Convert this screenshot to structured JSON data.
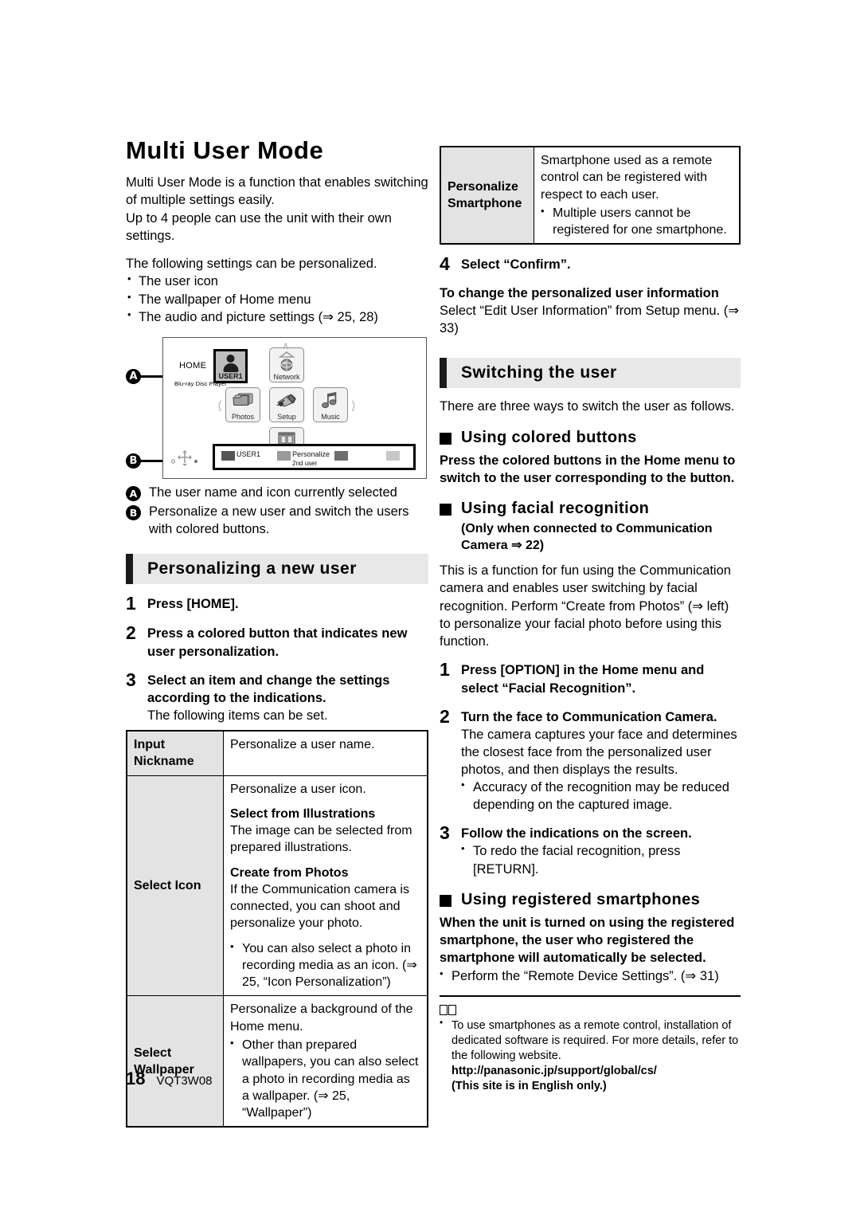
{
  "document": {
    "title": "Multi User Mode",
    "page_number": "18",
    "doc_code": "VQT3W08"
  },
  "left_column": {
    "intro_paragraph_1": "Multi User Mode is a function that enables switching of multiple settings easily.",
    "intro_paragraph_2": "Up to 4 people can use the unit with their own settings.",
    "personalized_lead": "The following settings can be personalized.",
    "personalized_items": [
      "The user icon",
      "The wallpaper of Home menu",
      "The audio and picture settings (⇒ 25, 28)"
    ],
    "figure": {
      "home_label": "HOME",
      "brand_label": "Blu-ray Disc Player",
      "user_tile_label": "USER1",
      "callout_a": "A",
      "callout_b": "B",
      "menu_items": [
        "Network",
        "Photos",
        "Setup",
        "Music",
        "Videos"
      ],
      "color_buttons": [
        {
          "label": "USER1",
          "sub": "",
          "color": "#555555"
        },
        {
          "label": "Personalize",
          "sub": "2nd user",
          "color": "#9a9a9a"
        },
        {
          "label": "",
          "sub": "",
          "color": "#6e6e6e"
        },
        {
          "label": "",
          "sub": "",
          "color": "#c7c7c7"
        }
      ]
    },
    "legend": [
      {
        "mark": "A",
        "text": "The user name and icon currently selected"
      },
      {
        "mark": "B",
        "text": "Personalize a new user and switch the users with colored buttons."
      }
    ],
    "section_heading": "Personalizing a new user",
    "steps": [
      {
        "num": "1",
        "text": "Press [HOME]."
      },
      {
        "num": "2",
        "text": "Press a colored button that indicates new user personalization."
      },
      {
        "num": "3",
        "text": "Select an item and change the settings according to the indications.",
        "sub": "The following items can be set."
      }
    ],
    "settings_table": [
      {
        "header": "Input Nickname",
        "body_intro": "Personalize a user name.",
        "groups": [],
        "bullets": []
      },
      {
        "header": "Select Icon",
        "body_intro": "Personalize a user icon.",
        "groups": [
          {
            "title": "Select from Illustrations",
            "text": "The image can be selected from prepared illustrations."
          },
          {
            "title": "Create from Photos",
            "text": "If the Communication camera is connected, you can shoot and personalize your photo."
          }
        ],
        "bullets": [
          "You can also select a photo in recording media as an icon. (⇒ 25, “Icon Personalization”)"
        ]
      },
      {
        "header": "Select Wallpaper",
        "body_intro": "Personalize a background of the Home menu.",
        "groups": [],
        "bullets": [
          "Other than prepared wallpapers, you can also select a photo in recording media as a wallpaper. (⇒ 25, “Wallpaper”)"
        ]
      }
    ]
  },
  "right_column": {
    "smartphone_table": {
      "header": "Personalize Smartphone",
      "body_intro": "Smartphone used as a remote control can be registered with respect to each user.",
      "bullets": [
        "Multiple users cannot be registered for one smartphone."
      ]
    },
    "step_4": {
      "num": "4",
      "text": "Select “Confirm”."
    },
    "change_info_heading": "To change the personalized user information",
    "change_info_text": "Select “Edit User Information” from Setup menu. (⇒ 33)",
    "section_heading": "Switching the user",
    "switch_intro": "There are three ways to switch the user as follows.",
    "colored_buttons": {
      "heading": "Using colored buttons",
      "body": "Press the colored buttons in the Home menu to switch to the user corresponding to the button."
    },
    "facial_recognition": {
      "heading": "Using facial recognition",
      "note": "(Only when connected to Communication Camera ⇒ 22)",
      "body": "This is a function for fun using the Communication camera and enables user switching by facial recognition. Perform “Create from Photos” (⇒ left) to personalize your facial photo before using this function.",
      "steps": [
        {
          "num": "1",
          "text": "Press [OPTION] in the Home menu and select “Facial Recognition”."
        },
        {
          "num": "2",
          "text": "Turn the face to Communication Camera.",
          "sub": "The camera captures your face and determines the closest face from the personalized user photos, and then displays the results.",
          "bullet": "Accuracy of the recognition may be reduced depending on the captured image."
        },
        {
          "num": "3",
          "text": "Follow the indications on the screen.",
          "bullet": "To redo the facial recognition, press [RETURN]."
        }
      ]
    },
    "registered_smartphones": {
      "heading": "Using registered smartphones",
      "body": "When the unit is turned on using the registered smartphone, the user who registered the smartphone will automatically be selected.",
      "bullet": "Perform the “Remote Device Settings”. (⇒ 31)"
    },
    "footnote": {
      "text": "To use smartphones as a remote control, installation of dedicated software is required. For more details, refer to the following website.",
      "url": "http://panasonic.jp/support/global/cs/",
      "url_note": "(This site is in English only.)"
    }
  }
}
